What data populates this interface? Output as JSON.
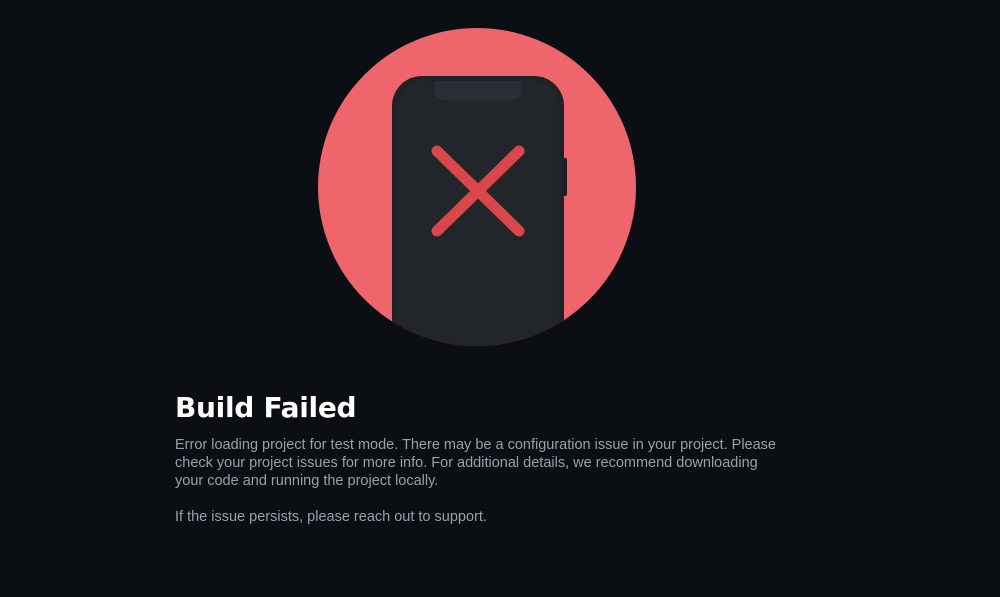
{
  "illustration": {
    "icon": "phone-error-icon",
    "circle_color": "#ee666b",
    "phone_color": "#1f2226",
    "cross_color": "#d9474c"
  },
  "error": {
    "title": "Build Failed",
    "message": "Error loading project for test mode. There may be a configuration issue in your project. Please check your project issues for more info. For additional details, we recommend downloading your code and running the project locally.",
    "support_text": "If the issue persists, please reach out to support."
  }
}
